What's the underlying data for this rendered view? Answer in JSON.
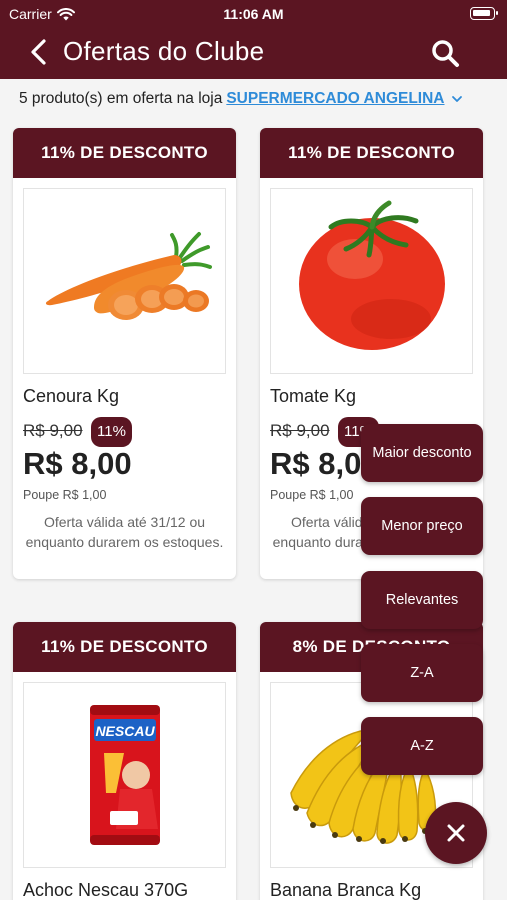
{
  "status_bar": {
    "carrier": "Carrier",
    "time": "11:06 AM"
  },
  "header": {
    "title": "Ofertas do Clube",
    "back_icon": "chevron-left-icon",
    "search_icon": "search-icon"
  },
  "store_bar": {
    "prefix": "5 produto(s) em oferta na loja",
    "store_name": "SUPERMERCADO ANGELINA"
  },
  "products": [
    {
      "badge": "11% DE DESCONTO",
      "name": "Cenoura Kg",
      "old_price": "R$ 9,00",
      "discount_tag": "11%",
      "price": "R$ 8,00",
      "savings": "Poupe R$ 1,00",
      "validity": "Oferta válida até 31/12 ou enquanto durarem os estoques.",
      "image": "carrot-image"
    },
    {
      "badge": "11% DE DESCONTO",
      "name": "Tomate Kg",
      "old_price": "R$ 9,00",
      "discount_tag": "11%",
      "price": "R$ 8,00",
      "savings": "Poupe R$ 1,00",
      "validity": "Oferta válida até 31/12 ou enquanto durarem os estoques.",
      "image": "tomato-image"
    },
    {
      "badge": "11% DE DESCONTO",
      "name": "Achoc Nescau 370G",
      "brand_text": "NESCAU",
      "image": "nescau-can-image"
    },
    {
      "badge": "8% DE DESCONTO",
      "name": "Banana Branca Kg",
      "image": "banana-image"
    }
  ],
  "sort_menu": {
    "options": [
      "Maior desconto",
      "Menor preço",
      "Relevantes",
      "Z-A",
      "A-Z"
    ],
    "close_icon": "close-icon"
  },
  "colors": {
    "brand": "#5b1522",
    "link": "#2e8bd8",
    "background": "#f4f4f4"
  }
}
